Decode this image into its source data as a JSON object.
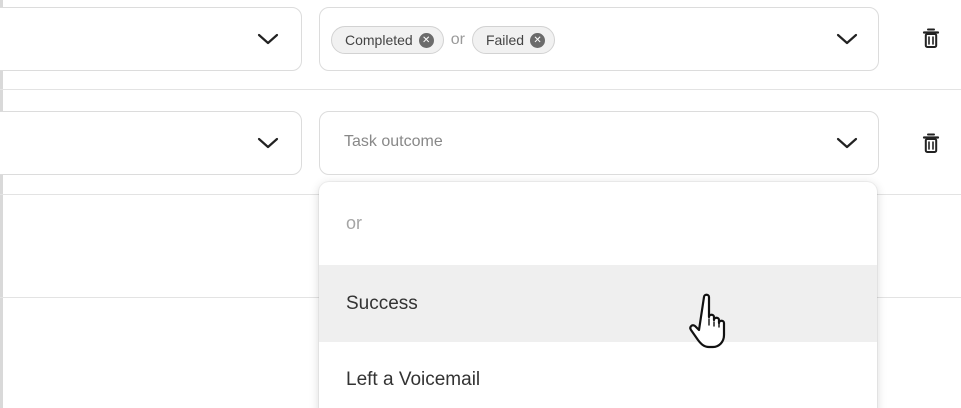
{
  "rows": [
    {
      "field_select": {
        "value": ""
      },
      "outcome_select": {
        "chips": [
          "Completed",
          "Failed"
        ],
        "separator": "or",
        "remove_icon": "x-circle-icon",
        "dropdown_icon": "chevron-down-icon"
      },
      "delete_icon": "trash-icon"
    },
    {
      "field_select": {
        "value": ""
      },
      "outcome_select": {
        "placeholder": "Task outcome",
        "dropdown_icon": "chevron-down-icon"
      },
      "delete_icon": "trash-icon"
    }
  ],
  "dropdown": {
    "items": [
      {
        "label": "or",
        "kind": "separator"
      },
      {
        "label": "Success",
        "state": "hover"
      },
      {
        "label": "Left a Voicemail"
      }
    ]
  },
  "cursor": {
    "type": "hand-pointer-icon"
  },
  "colors": {
    "border": "#dcdcdc",
    "chip_bg": "#f1f1f1",
    "hover_bg": "#efefef",
    "placeholder": "#888888",
    "icon": "#222222"
  }
}
